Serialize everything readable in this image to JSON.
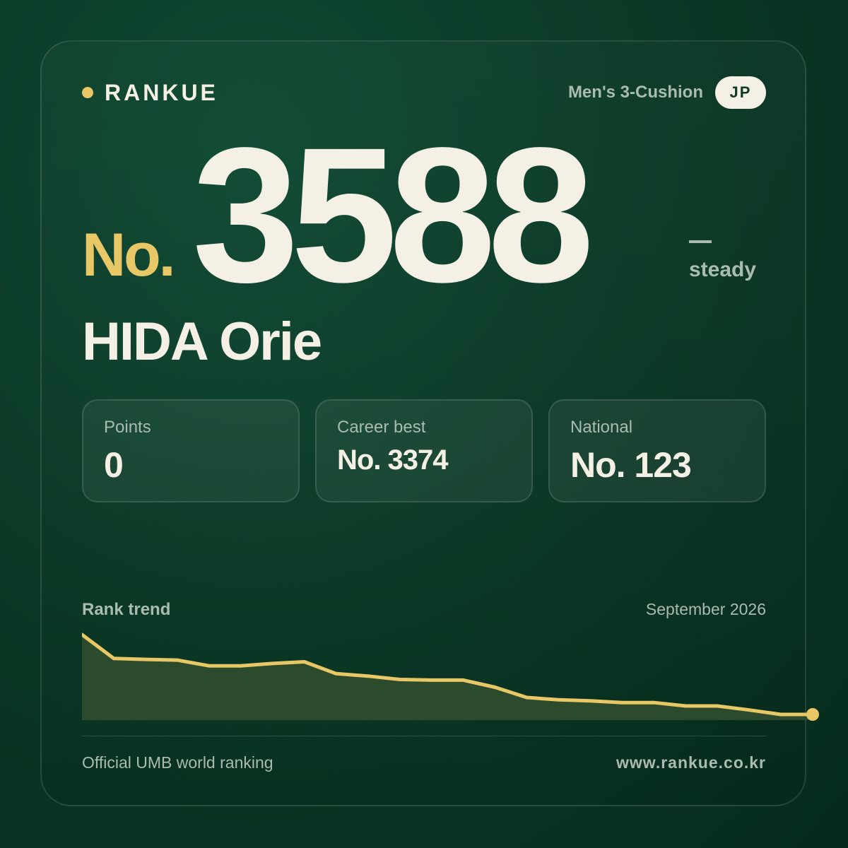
{
  "brand": {
    "name": "RANKUE",
    "accent_color": "#e8c766"
  },
  "header": {
    "category": "Men's 3-Cushion",
    "country": "JP"
  },
  "rank": {
    "prefix": "No.",
    "number": "3588",
    "trend_label": "steady"
  },
  "player": {
    "name": "HIDA Orie"
  },
  "stats": [
    {
      "label": "Points",
      "value": "0"
    },
    {
      "label": "Career best",
      "value": "No. 3374"
    },
    {
      "label": "National",
      "value": "No. 123"
    }
  ],
  "trend": {
    "title": "Rank trend",
    "date": "September 2026"
  },
  "chart_data": {
    "type": "area",
    "values": [
      4100,
      4030,
      4027,
      4025,
      4008,
      4008,
      4015,
      4020,
      3985,
      3978,
      3968,
      3966,
      3966,
      3945,
      3915,
      3908,
      3905,
      3900,
      3900,
      3890,
      3890,
      3878,
      3865,
      3865
    ],
    "y_inverted": true,
    "line_color": "#e8c766",
    "fill_color": "#2c4a2c",
    "grid": false,
    "legend": "none"
  },
  "footer": {
    "source": "Official UMB world ranking",
    "url": "www.rankue.co.kr"
  }
}
